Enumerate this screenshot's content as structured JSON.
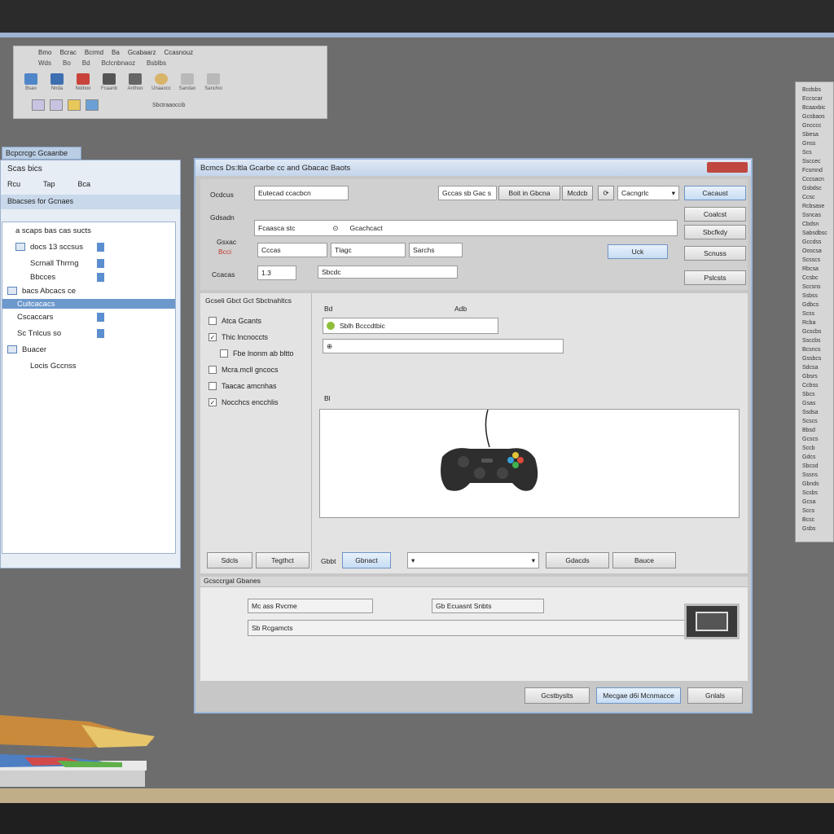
{
  "ribbon": {
    "tabs": [
      "Bmo",
      "Bcrac",
      "Bcrmd",
      "Ba",
      "Gcabaarz",
      "Ccasnouz"
    ],
    "subtabs": [
      "Wds",
      "Bo",
      "Bd",
      "Bclcnbnaoz",
      "Bsblbs"
    ],
    "tool_labels": [
      "Bsao",
      "Nnda",
      "Noiboo",
      "Fcaanb",
      "Anthoo",
      "Unaaocc",
      "Sandao",
      "Sanchoi"
    ],
    "bottom_label": "Sbctraaoccib"
  },
  "explorer": {
    "caption": "Bcpcrcgc Gcaanbe",
    "title": "Scas bics",
    "menu": [
      "Rcu",
      "Tap",
      "Bca"
    ],
    "header": "Bbacses for Gcnaes",
    "items": [
      "a scaps bas cas sucts",
      "docs 13 sccsus",
      "Scrnall Thrrng",
      "Bbcces",
      "bacs Abcacs ce",
      "Cuitcacacs",
      "Cscaccars",
      "Sc Tnlcus so",
      "Buacer",
      "Locis Gccnss"
    ]
  },
  "dialog": {
    "title": "Bcmcs Ds:ltla Gcarbe cc and Gbacac Baots",
    "labels": {
      "row1": "Ocdcus",
      "row2": "Gdsadn",
      "row3": "Gsxac",
      "row3_red": "Bcci",
      "row4": "Ccacas"
    },
    "fields": {
      "primary": "Eutecad ccacbcn",
      "secondary": "Fcaasca stc",
      "tertiary": "Gcachcact",
      "small1": "Cccas",
      "small2": "Tlagc",
      "small3": "Sarchs",
      "nums": "1.3",
      "status": "Sbcdc"
    },
    "top_tabs": [
      "Gccas sb Gac s",
      "Boit in Gbcna",
      "Mcdcb"
    ],
    "dropdown_label": "Cacngrlc",
    "side_buttons": [
      "Cacaust",
      "Coalcst",
      "Sbcfkdy",
      "Scnuss",
      "Pslcsts"
    ],
    "ok_button": "Uck",
    "section_title": "Gcseli Gbct Gct Sbctnahltcs",
    "options": [
      {
        "label": "Atca Gcants",
        "checked": false
      },
      {
        "label": "Thic lncnoccts",
        "checked": true
      },
      {
        "label": "Fbe lnonm ab bltto",
        "checked": false
      },
      {
        "label": "Mcra.mcll gncocs",
        "checked": false
      },
      {
        "label": "Taacac amcnhas",
        "checked": false
      },
      {
        "label": "Nocchcs encchlis",
        "checked": true
      }
    ],
    "content_labels": {
      "col_a": "Bd",
      "col_b": "Adb",
      "search_value": "Sblh Bcccdtbic",
      "misc": "Bl"
    },
    "footer_buttons": {
      "left1": "Sdcls",
      "left2": "Tegthct",
      "label": "Gbbt",
      "primary": "Gbnact",
      "select_value": "",
      "right1": "Gdacds",
      "right2": "Bauce"
    },
    "section2": {
      "title": "Gcsccrgal Gbanes",
      "row1_a": "Mc ass Rvcme",
      "row1_b": "Gb Ecuasnt Snbts",
      "row2_a": "Sb Rcgamcts"
    },
    "bottom_buttons": [
      "Gcstbyslts",
      "Mecgae d6i Mcnmacce",
      "Gnlals"
    ]
  },
  "right_panel": {
    "lines": [
      "Bcdsbs",
      "Eccscar",
      "Bcaaxbic",
      "Gcsbaos",
      "Gncccc",
      "Sbesa",
      "Gnss",
      "Scs",
      "Ssccec",
      "Fcsmnd",
      "Cccsacn",
      "Gsbdsc",
      "Ccsc",
      "Rcbsase",
      "Ssncas",
      "Cbdsn",
      "Sabsdbsc",
      "Gccdss",
      "Ooscsa",
      "Scsscs",
      "Rbcsa",
      "Ccsbc",
      "Sccsns",
      "Ssbss",
      "Gdbcs",
      "Scss",
      "Rcba",
      "Gcscbs",
      "Ssccbs",
      "Bcsncs",
      "Gssbcs",
      "Sdcsa",
      "Gbsrs",
      "Ccbss",
      "Sbcs",
      "Gsas",
      "Ssdsa",
      "Scscs",
      "Bbsd",
      "Gcscs",
      "Sccb",
      "Gdcs",
      "Sbcsd",
      "Sssns",
      "Gbnds",
      "Scsbs",
      "Gcsa",
      "Sccs",
      "Bcsc",
      "Gsbs"
    ]
  },
  "colors": {
    "desktop": "#6d6d6d",
    "accent": "#6d98cc",
    "close": "#c0473f",
    "controller_buttons": [
      "#3aa0d8",
      "#3fb34f",
      "#e2c23a",
      "#d94a3b"
    ]
  }
}
